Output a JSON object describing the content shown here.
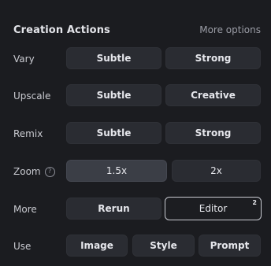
{
  "header": {
    "title": "Creation Actions",
    "more_options": "More options"
  },
  "rows": {
    "vary": {
      "label": "Vary",
      "buttons": [
        "Subtle",
        "Strong"
      ]
    },
    "upscale": {
      "label": "Upscale",
      "buttons": [
        "Subtle",
        "Creative"
      ]
    },
    "remix": {
      "label": "Remix",
      "buttons": [
        "Subtle",
        "Strong"
      ]
    },
    "zoom": {
      "label": "Zoom",
      "help_icon_text": "?",
      "buttons": [
        "1.5x",
        "2x"
      ],
      "selected": "1.5x"
    },
    "more": {
      "label": "More",
      "buttons": [
        "Rerun",
        "Editor"
      ],
      "editor_badge": "2"
    },
    "use": {
      "label": "Use",
      "buttons": [
        "Image",
        "Style",
        "Prompt"
      ]
    }
  },
  "icons": {
    "help": "help-circle-icon"
  }
}
